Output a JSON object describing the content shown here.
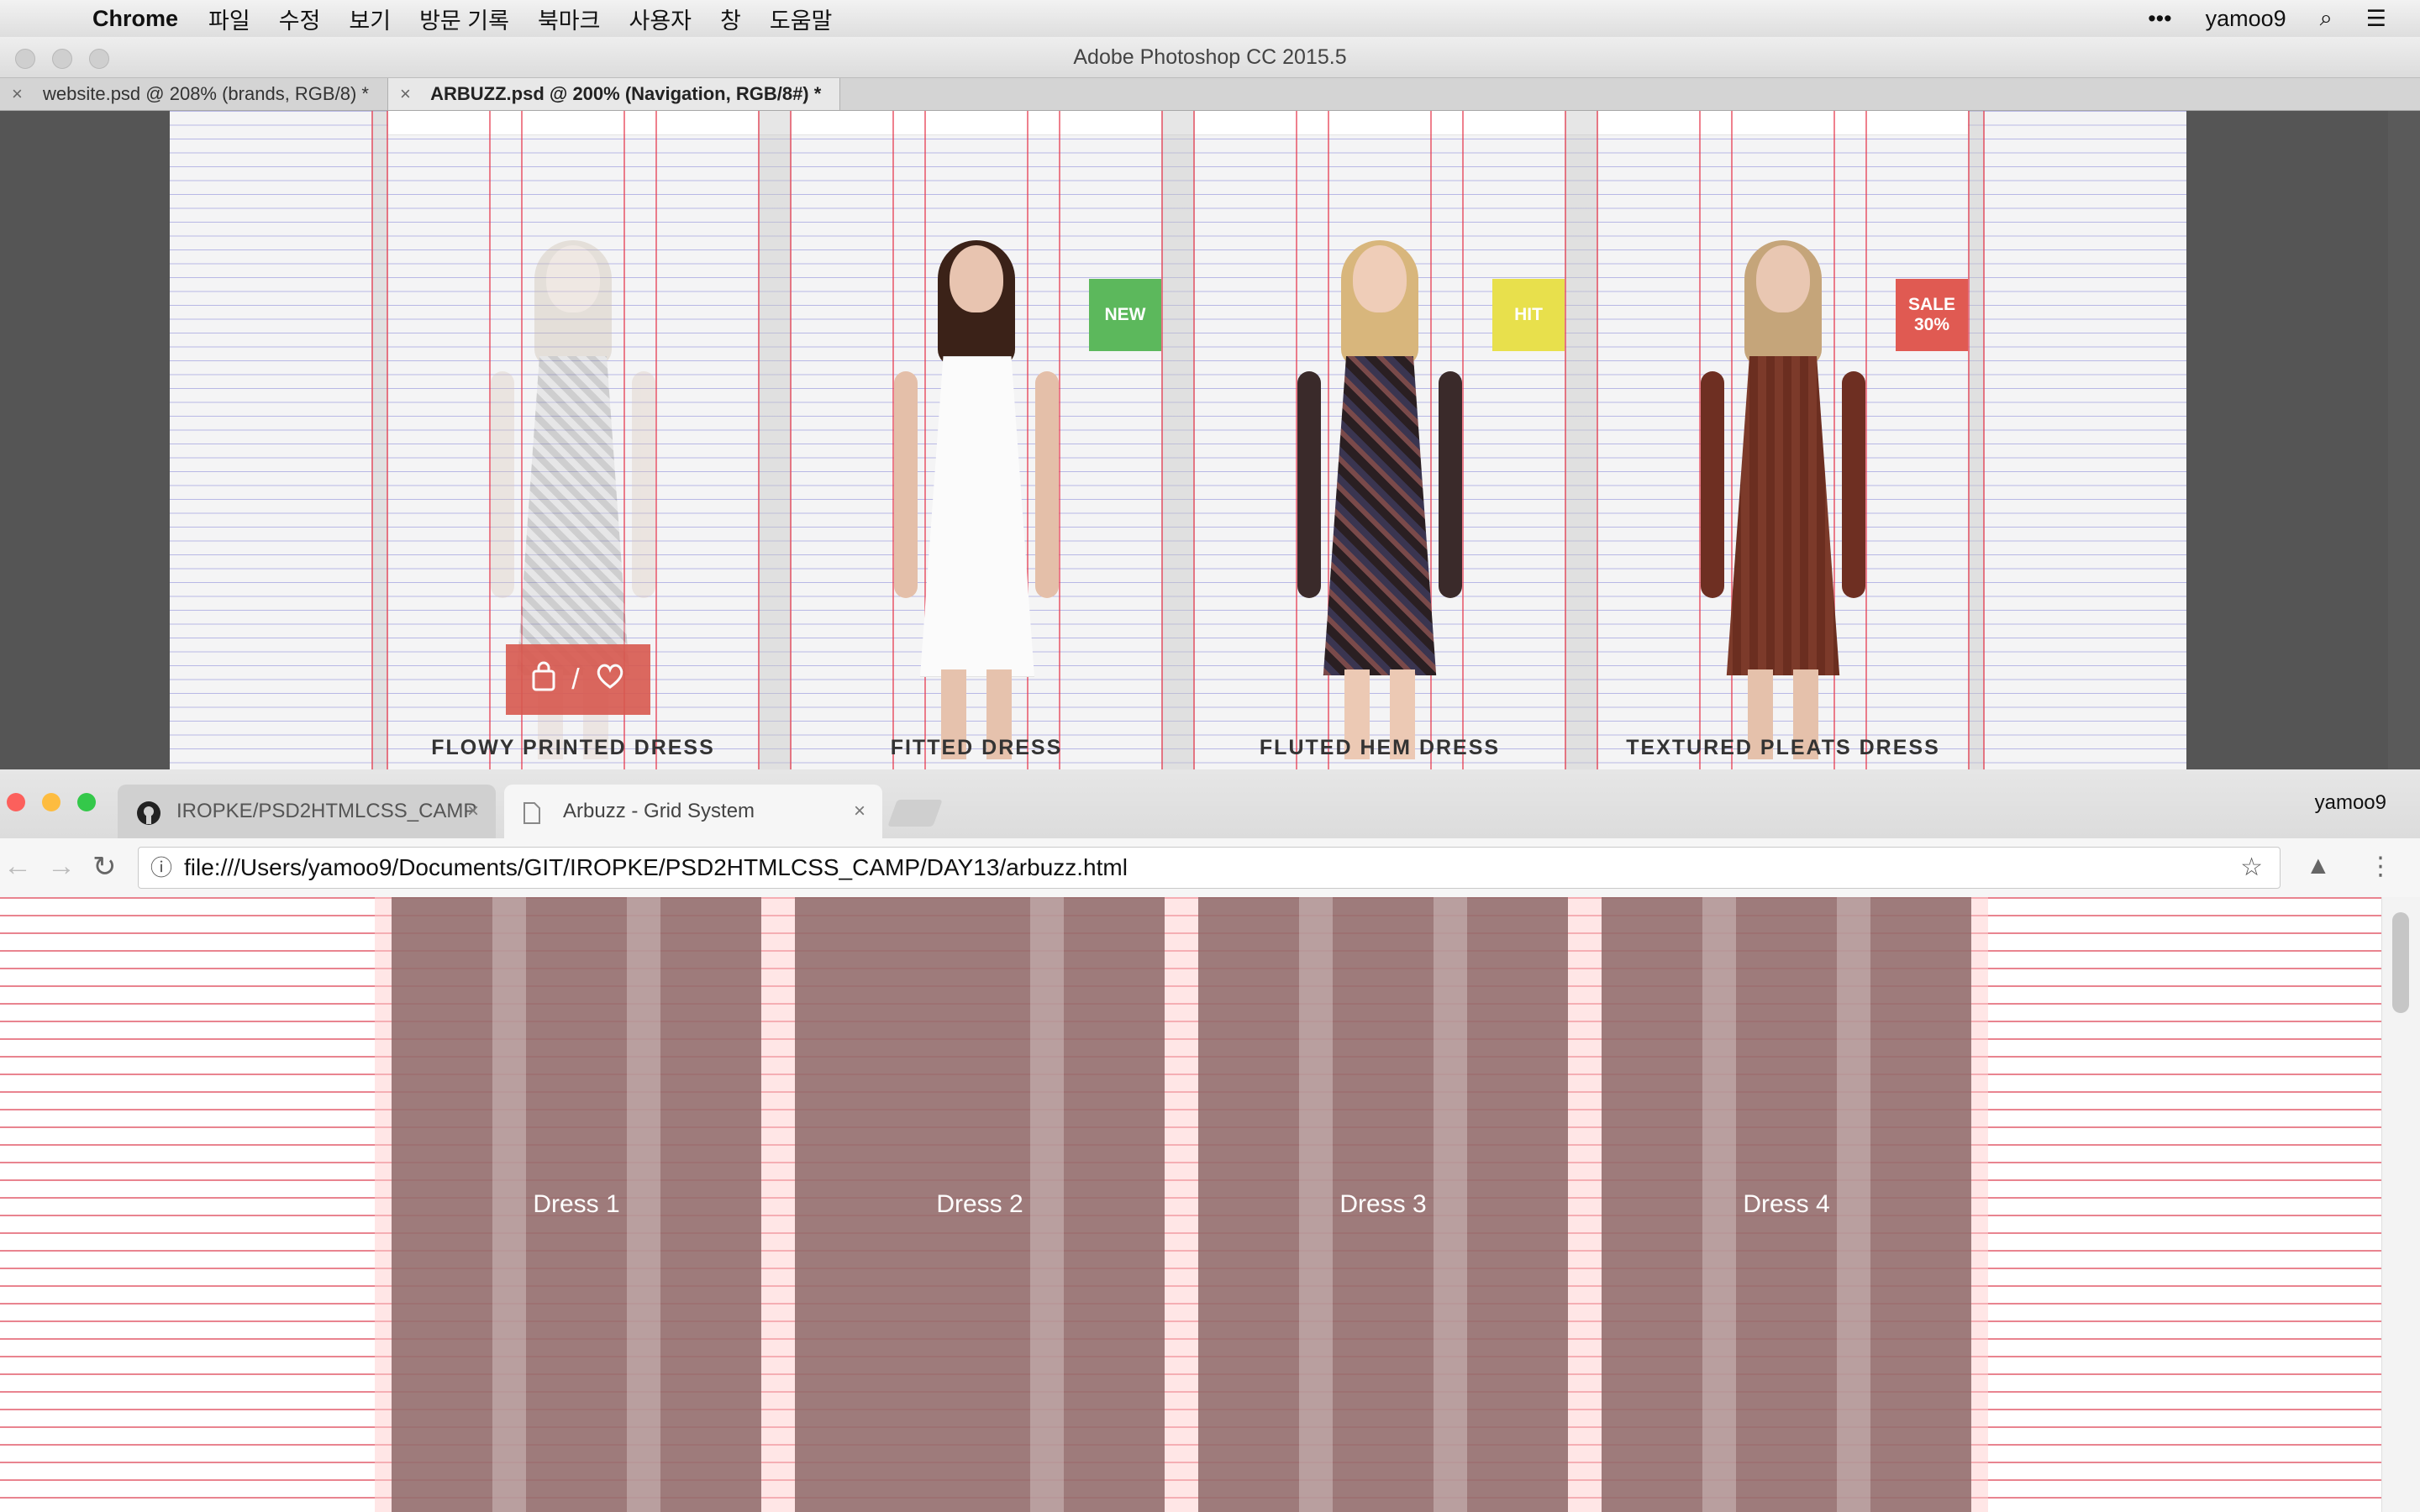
{
  "menubar": {
    "app_name": "Chrome",
    "items": [
      "파일",
      "수정",
      "보기",
      "방문 기록",
      "북마크",
      "사용자",
      "창",
      "도움말"
    ],
    "more": "•••",
    "user": "yamoo9",
    "apple_icon": "",
    "search_icon": "⌕",
    "list_icon": "☰"
  },
  "photoshop": {
    "title": "Adobe Photoshop CC 2015.5",
    "tabs": [
      {
        "label": "website.psd @ 208% (brands, RGB/8) *",
        "close": "×"
      },
      {
        "label": "ARBUZZ.psd @ 200% (Navigation, RGB/8#) *",
        "close": "×"
      }
    ],
    "products": [
      {
        "name": "FLOWY PRINTED DRESS",
        "badge": ""
      },
      {
        "name": "FITTED DRESS",
        "badge": "NEW"
      },
      {
        "name": "FLUTED HEM DRESS",
        "badge": "HIT"
      },
      {
        "name": "TEXTURED PLEATS DRESS",
        "badge_line1": "SALE",
        "badge_line2": "30%"
      }
    ],
    "cart_divider": "/",
    "badge_colors": {
      "new": "#5cb85c",
      "hit": "#e8e04c",
      "sale": "#e05a52"
    }
  },
  "chrome": {
    "tabs": [
      {
        "label": "IROPKE/PSD2HTMLCSS_CAMP",
        "close": "×"
      },
      {
        "label": "Arbuzz - Grid System",
        "close": "×"
      }
    ],
    "user": "yamoo9",
    "url": "file:///Users/yamoo9/Documents/GIT/IROPKE/PSD2HTMLCSS_CAMP/DAY13/arbuzz.html",
    "back_icon": "←",
    "forward_icon": "→",
    "reload_icon": "↻",
    "info_icon": "ⓘ",
    "star_icon": "☆",
    "ext_icon": "▲",
    "menu_icon": "⋮",
    "columns": [
      "Dress 1",
      "Dress 2",
      "Dress 3",
      "Dress 4"
    ]
  }
}
